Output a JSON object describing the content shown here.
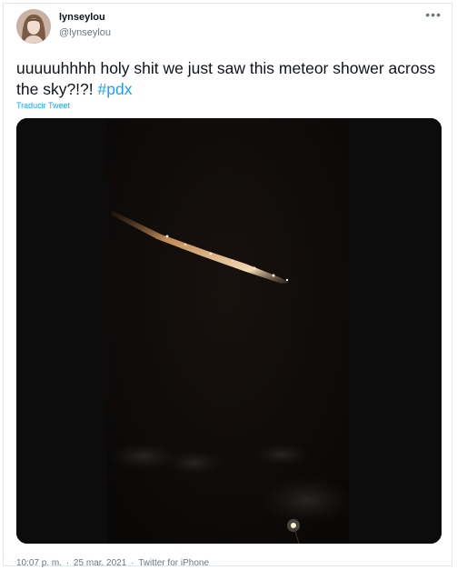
{
  "author": {
    "display_name": "lynseylou",
    "handle": "@lynseylou",
    "avatar_icon": "profile-photo"
  },
  "menu_icon": "more-horizontal-icon",
  "tweet": {
    "text": "uuuuuhhhh holy shit we just saw this meteor shower across the sky?!?! ",
    "hashtag": "#pdx",
    "translate_label": "Traducir Tweet"
  },
  "meta": {
    "time": "10:07 p. m.",
    "sep1": " · ",
    "date": "25 mar. 2021",
    "sep2": " · ",
    "source": "Twitter for iPhone"
  },
  "colors": {
    "link": "#1da1f2",
    "muted": "#6b7780",
    "text": "#0f1419",
    "border": "#e1e8ed"
  }
}
